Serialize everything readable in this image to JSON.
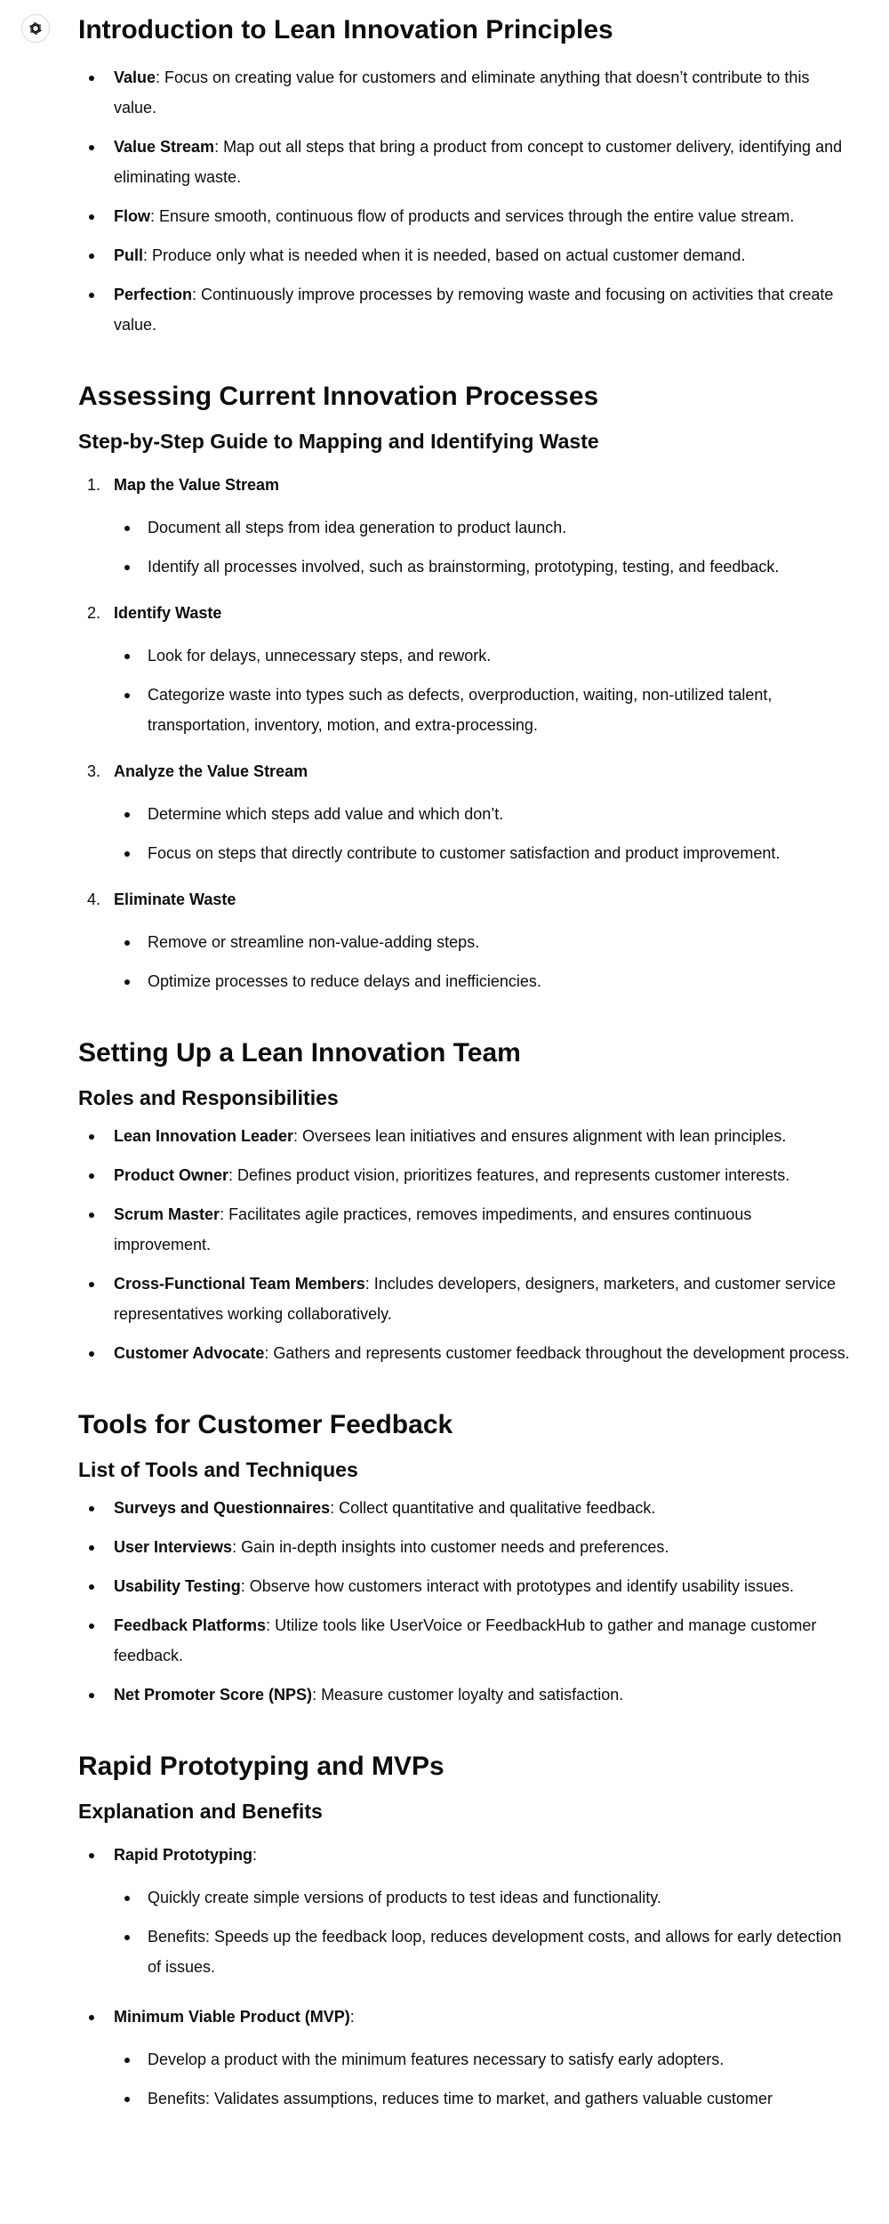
{
  "assistant": {
    "icon": "openai-logo-icon"
  },
  "sections": {
    "intro": {
      "title": "Introduction to Lean Innovation Principles",
      "items": [
        {
          "term": "Value",
          "desc": ": Focus on creating value for customers and eliminate anything that doesn’t contribute to this value."
        },
        {
          "term": "Value Stream",
          "desc": ": Map out all steps that bring a product from concept to customer delivery, identifying and eliminating waste."
        },
        {
          "term": "Flow",
          "desc": ": Ensure smooth, continuous flow of products and services through the entire value stream."
        },
        {
          "term": "Pull",
          "desc": ": Produce only what is needed when it is needed, based on actual customer demand."
        },
        {
          "term": "Perfection",
          "desc": ": Continuously improve processes by removing waste and focusing on activities that create value."
        }
      ]
    },
    "assess": {
      "title": "Assessing Current Innovation Processes",
      "subtitle": "Step-by-Step Guide to Mapping and Identifying Waste",
      "steps": [
        {
          "num": "1.",
          "title": "Map the Value Stream",
          "items": [
            "Document all steps from idea generation to product launch.",
            "Identify all processes involved, such as brainstorming, prototyping, testing, and feedback."
          ]
        },
        {
          "num": "2.",
          "title": "Identify Waste",
          "items": [
            "Look for delays, unnecessary steps, and rework.",
            "Categorize waste into types such as defects, overproduction, waiting, non-utilized talent, transportation, inventory, motion, and extra-processing."
          ]
        },
        {
          "num": "3.",
          "title": "Analyze the Value Stream",
          "items": [
            "Determine which steps add value and which don’t.",
            "Focus on steps that directly contribute to customer satisfaction and product improvement."
          ]
        },
        {
          "num": "4.",
          "title": "Eliminate Waste",
          "items": [
            "Remove or streamline non-value-adding steps.",
            "Optimize processes to reduce delays and inefficiencies."
          ]
        }
      ]
    },
    "team": {
      "title": "Setting Up a Lean Innovation Team",
      "subtitle": "Roles and Responsibilities",
      "items": [
        {
          "term": "Lean Innovation Leader",
          "desc": ": Oversees lean initiatives and ensures alignment with lean principles."
        },
        {
          "term": "Product Owner",
          "desc": ": Defines product vision, prioritizes features, and represents customer interests."
        },
        {
          "term": "Scrum Master",
          "desc": ": Facilitates agile practices, removes impediments, and ensures continuous improvement."
        },
        {
          "term": "Cross-Functional Team Members",
          "desc": ": Includes developers, designers, marketers, and customer service representatives working collaboratively."
        },
        {
          "term": "Customer Advocate",
          "desc": ": Gathers and represents customer feedback throughout the development process."
        }
      ]
    },
    "tools": {
      "title": "Tools for Customer Feedback",
      "subtitle": "List of Tools and Techniques",
      "items": [
        {
          "term": "Surveys and Questionnaires",
          "desc": ": Collect quantitative and qualitative feedback."
        },
        {
          "term": "User Interviews",
          "desc": ": Gain in-depth insights into customer needs and preferences."
        },
        {
          "term": "Usability Testing",
          "desc": ": Observe how customers interact with prototypes and identify usability issues."
        },
        {
          "term": "Feedback Platforms",
          "desc": ": Utilize tools like UserVoice or FeedbackHub to gather and manage customer feedback."
        },
        {
          "term": "Net Promoter Score (NPS)",
          "desc": ": Measure customer loyalty and satisfaction."
        }
      ]
    },
    "proto": {
      "title": "Rapid Prototyping and MVPs",
      "subtitle": "Explanation and Benefits",
      "groups": [
        {
          "term": "Rapid Prototyping",
          "suffix": ":",
          "items": [
            "Quickly create simple versions of products to test ideas and functionality.",
            "Benefits: Speeds up the feedback loop, reduces development costs, and allows for early detection of issues."
          ]
        },
        {
          "term": "Minimum Viable Product (MVP)",
          "suffix": ":",
          "items": [
            "Develop a product with the minimum features necessary to satisfy early adopters.",
            "Benefits: Validates assumptions, reduces time to market, and gathers valuable customer"
          ]
        }
      ]
    }
  }
}
